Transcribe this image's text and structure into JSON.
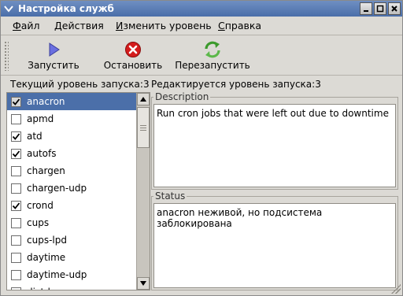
{
  "window": {
    "title": "Настройка служб"
  },
  "menu": [
    {
      "label": "Файл",
      "accel": "Ф",
      "rest": "айл"
    },
    {
      "label": "Действия",
      "accel": "Д",
      "rest": "ействия"
    },
    {
      "label": "Изменить уровень",
      "accel": "И",
      "rest": "зменить уровень"
    },
    {
      "label": "Справка",
      "accel": "С",
      "rest": "правка"
    }
  ],
  "toolbar": {
    "start_label": "Запустить",
    "stop_label": "Остановить",
    "restart_label": "Перезапустить"
  },
  "runlevel": {
    "current": "Текущий уровень запуска:3",
    "editing": "Редактируется уровень запуска:3"
  },
  "services": [
    {
      "name": "anacron",
      "checked": true,
      "selected": true
    },
    {
      "name": "apmd",
      "checked": false,
      "selected": false
    },
    {
      "name": "atd",
      "checked": true,
      "selected": false
    },
    {
      "name": "autofs",
      "checked": true,
      "selected": false
    },
    {
      "name": "chargen",
      "checked": false,
      "selected": false
    },
    {
      "name": "chargen-udp",
      "checked": false,
      "selected": false
    },
    {
      "name": "crond",
      "checked": true,
      "selected": false
    },
    {
      "name": "cups",
      "checked": false,
      "selected": false
    },
    {
      "name": "cups-lpd",
      "checked": false,
      "selected": false
    },
    {
      "name": "daytime",
      "checked": false,
      "selected": false
    },
    {
      "name": "daytime-udp",
      "checked": false,
      "selected": false
    },
    {
      "name": "dictd",
      "checked": false,
      "selected": false
    }
  ],
  "description": {
    "label": "Description",
    "text": "Run cron jobs that were left out due to downtime"
  },
  "status": {
    "label": "Status",
    "text": "anacron неживой, но подсистема заблокирована"
  },
  "colors": {
    "titlebar": "#4a6ea9",
    "selection": "#4b6fa9",
    "stop_red": "#d41c1c",
    "restart_green": "#3c9a2c",
    "start_blue": "#5a5fd0"
  },
  "icons": {
    "start": "play-icon",
    "stop": "stop-icon",
    "restart": "restart-icon"
  }
}
